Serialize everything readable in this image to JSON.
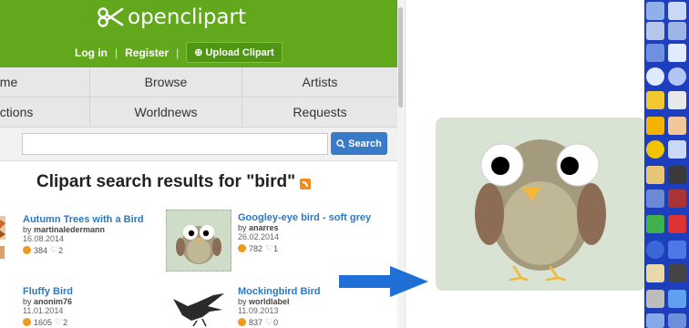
{
  "header": {
    "brand": "openclipart",
    "login": "Log in",
    "register": "Register",
    "upload": "⊕ Upload Clipart",
    "separator": "|"
  },
  "nav": {
    "row1": [
      "ome",
      "Browse",
      "Artists"
    ],
    "row2": [
      "ections",
      "Worldnews",
      "Requests"
    ]
  },
  "search": {
    "placeholder": "",
    "button": "Search"
  },
  "results": {
    "heading": "Clipart search results for \"bird\"",
    "items": [
      {
        "title": "Autumn Trees with a Bird",
        "by": "by",
        "author": "martinaledermann",
        "date": "16.08.2014",
        "downloads": "384",
        "favorites": "2"
      },
      {
        "title": "Googley-eye bird - soft grey",
        "by": "by",
        "author": "anarres",
        "date": "26.02.2014",
        "downloads": "782",
        "favorites": "1"
      },
      {
        "title": "Fluffy Bird",
        "by": "by",
        "author": "anonim76",
        "date": "11.01.2014",
        "downloads": "1605",
        "favorites": "2"
      },
      {
        "title": "Mockingbird Bird",
        "by": "by",
        "author": "worldlabel",
        "date": "11.09.2013",
        "downloads": "837",
        "favorites": "0"
      }
    ]
  },
  "colors": {
    "brand_green": "#62a81c",
    "link_blue": "#2b79c2",
    "arrow_blue": "#1f6fd6",
    "toolbar_blue": "#1d3fbd"
  },
  "icons": [
    "scissors-icon",
    "rss-icon",
    "search-icon",
    "download-count-icon",
    "heart-icon",
    "arrow-right-icon"
  ]
}
